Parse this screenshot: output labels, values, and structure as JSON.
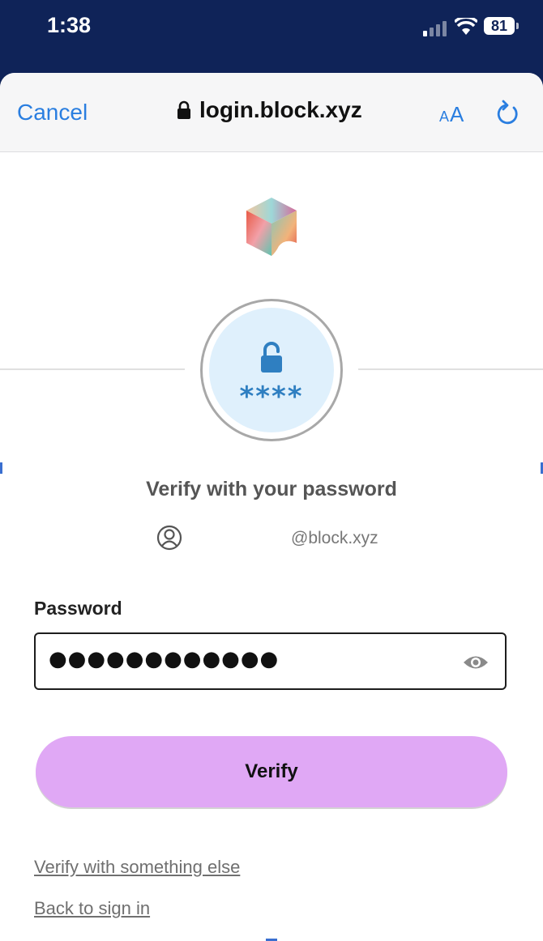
{
  "status_bar": {
    "time": "1:38",
    "battery": "81"
  },
  "browser": {
    "cancel_label": "Cancel",
    "url": "login.block.xyz",
    "text_size_label_small": "A",
    "text_size_label_large": "A"
  },
  "auth": {
    "badge_masked": "****",
    "heading": "Verify with your password",
    "email_domain": "@block.xyz"
  },
  "form": {
    "password_label": "Password",
    "password_value": "●●●●●●●●●●●●",
    "submit_label": "Verify"
  },
  "links": {
    "alternate": "Verify with something else",
    "back": "Back to sign in"
  },
  "colors": {
    "status_bg": "#0f2358",
    "accent_blue": "#2a7ee0",
    "verify_button": "#e0a8f5",
    "badge_fill": "#dff0fc"
  }
}
